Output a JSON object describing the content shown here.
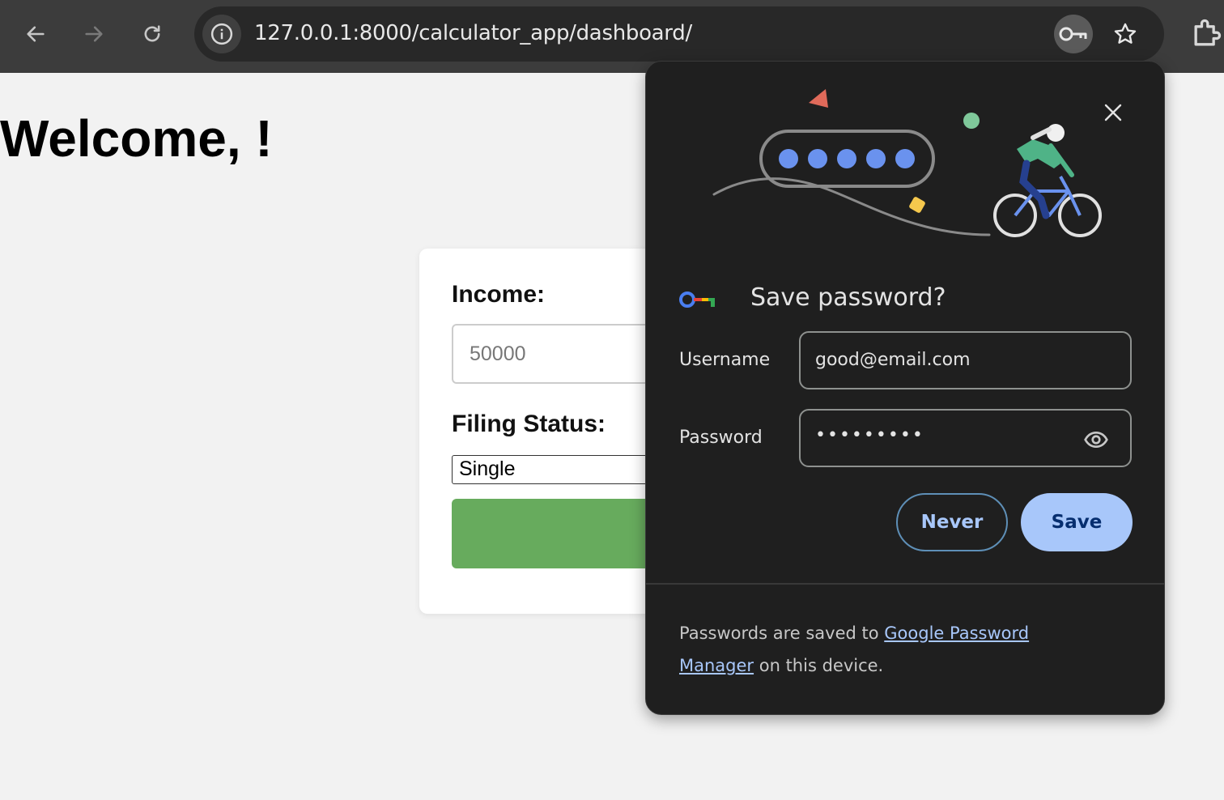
{
  "browser": {
    "url": "127.0.0.1:8000/calculator_app/dashboard/"
  },
  "page": {
    "welcome": "Welcome, !",
    "form": {
      "income_label": "Income:",
      "income_placeholder": "50000",
      "filing_label": "Filing Status:",
      "filing_value": "Single",
      "submit_color": "#67ab5d"
    }
  },
  "popup": {
    "title": "Save password?",
    "username_label": "Username",
    "username_value": "good@email.com",
    "password_label": "Password",
    "password_masked": "•••••••••",
    "never_label": "Never",
    "save_label": "Save",
    "footer_prefix": "Passwords are saved to ",
    "footer_link": "Google Password Manager",
    "footer_suffix": " on this device.",
    "accent": "#a8c7fa"
  },
  "icons": [
    "back-icon",
    "forward-icon",
    "reload-icon",
    "site-info-icon",
    "key-icon",
    "star-icon",
    "extensions-icon",
    "close-icon",
    "password-manager-logo-icon",
    "eye-icon"
  ]
}
